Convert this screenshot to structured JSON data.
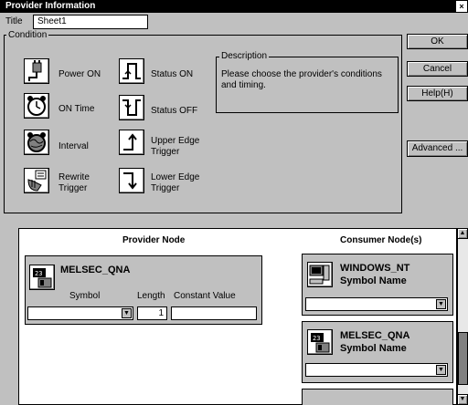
{
  "window": {
    "title": "Provider Information",
    "close_glyph": "×"
  },
  "title_field": {
    "label": "Title",
    "value": "Sheet1"
  },
  "condition": {
    "group_label": "Condition",
    "items": [
      {
        "label": "Power ON",
        "icon": "power-plug-icon"
      },
      {
        "label": "ON Time",
        "icon": "alarm-clock-icon"
      },
      {
        "label": "Interval",
        "icon": "globe-clock-icon"
      },
      {
        "label": "Rewrite Trigger",
        "icon": "pen-hand-icon"
      },
      {
        "label": "Status ON",
        "icon": "pulse-rising-icon"
      },
      {
        "label": "Status OFF",
        "icon": "pulse-falling-icon"
      },
      {
        "label": "Upper Edge Trigger",
        "icon": "arrow-up-edge-icon"
      },
      {
        "label": "Lower Edge Trigger",
        "icon": "arrow-down-edge-icon"
      }
    ]
  },
  "description": {
    "label": "Description",
    "text": "Please choose the provider's conditions and timing."
  },
  "buttons": {
    "ok": "OK",
    "cancel": "Cancel",
    "help": "Help(H)",
    "advanced": "Advanced ..."
  },
  "provider": {
    "header": "Provider Node",
    "node_name": "MELSEC_QNA",
    "symbol_label": "Symbol",
    "length_label": "Length",
    "constant_label": "Constant Value",
    "symbol_value": "",
    "length_value": "1",
    "constant_value": ""
  },
  "consumers": {
    "header": "Consumer Node(s)",
    "nodes": [
      {
        "name": "WINDOWS_NT",
        "symbol_label": "Symbol Name",
        "value": ""
      },
      {
        "name": "MELSEC_QNA",
        "symbol_label": "Symbol Name",
        "value": ""
      }
    ]
  },
  "colors": {
    "window_bg": "#c0c0c0",
    "titlebar": "#000000",
    "panel_bg": "#ffffff"
  }
}
